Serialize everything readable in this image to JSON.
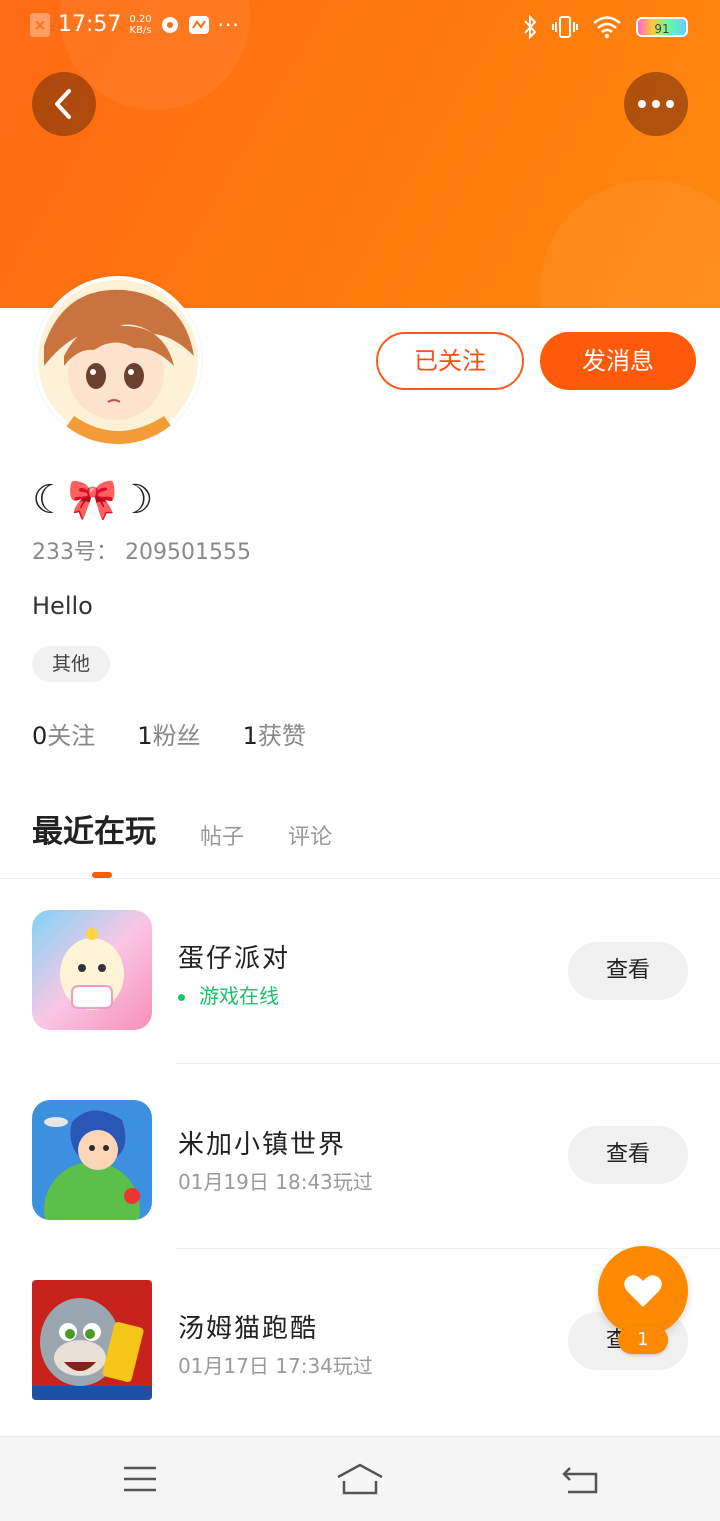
{
  "status_bar": {
    "time": "17:57",
    "speed_value": "0.20",
    "speed_unit": "KB/s",
    "more": "···",
    "battery": "91"
  },
  "colors": {
    "accent": "#ff5a0a",
    "header": "#ff7a0d",
    "online": "#19c26a",
    "fab": "#ff8a00"
  },
  "profile": {
    "nickname": "☾🎀☽",
    "user_id": "233号： 209501555",
    "bio": "Hello",
    "tag": "其他",
    "followed_label": "已关注",
    "message_label": "发消息",
    "stats": [
      {
        "num": "0",
        "label": "关注"
      },
      {
        "num": "1",
        "label": "粉丝"
      },
      {
        "num": "1",
        "label": "获赞"
      }
    ]
  },
  "tabs": [
    {
      "label": "最近在玩"
    },
    {
      "label": "帖子"
    },
    {
      "label": "评论"
    }
  ],
  "games": [
    {
      "title": "蛋仔派对",
      "status": "游戏在线",
      "view_label": "查看"
    },
    {
      "title": "米加小镇世界",
      "status": "01月19日 18:43玩过",
      "view_label": "查看"
    },
    {
      "title": "汤姆猫跑酷",
      "status": "01月17日 17:34玩过",
      "view_label": "查看"
    }
  ],
  "fab": {
    "count": "1",
    "icon": "heart-icon"
  },
  "nav": {
    "icons": [
      "menu-icon",
      "home-icon",
      "back-icon"
    ]
  }
}
